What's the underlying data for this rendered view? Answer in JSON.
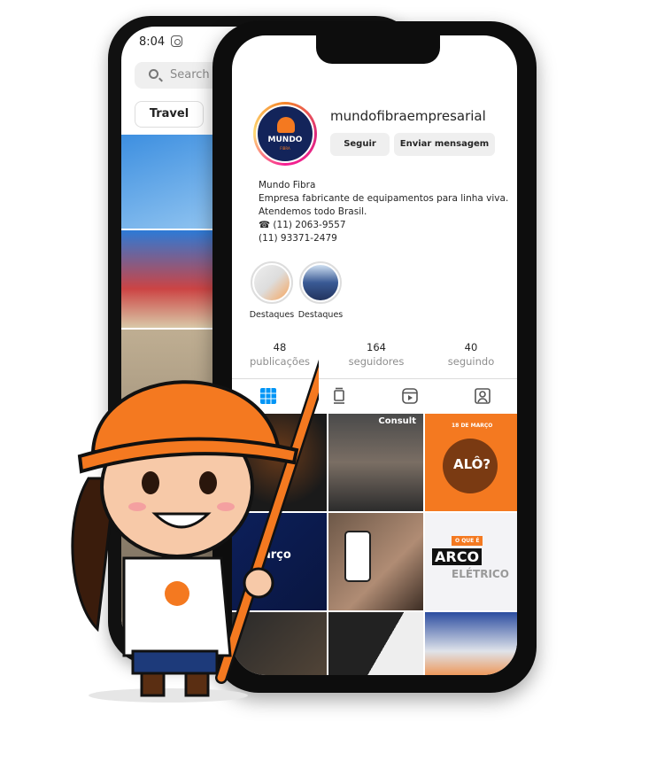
{
  "back_phone": {
    "status_time": "8:04",
    "search_placeholder": "Search",
    "chip": "Travel"
  },
  "profile": {
    "username": "mundofibraempresarial",
    "avatar_brand": "MUNDO",
    "avatar_sub": "FIBRA",
    "follow_button": "Seguir",
    "message_button": "Enviar mensagem",
    "name": "Mundo Fibra",
    "bio_line1": "Empresa fabricante de equipamentos para linha viva.",
    "bio_line2": "Atendemos todo Brasil.",
    "phone1": "☎ (11) 2063-9557",
    "phone2": "(11) 93371-2479",
    "highlights": [
      {
        "label": "Destaques"
      },
      {
        "label": "Destaques"
      }
    ],
    "stats": [
      {
        "value": "48",
        "label": "publicações"
      },
      {
        "value": "164",
        "label": "seguidores"
      },
      {
        "value": "40",
        "label": "seguindo"
      }
    ],
    "tabs": [
      "grid-icon",
      "igtv-icon",
      "reels-icon",
      "tagged-icon"
    ],
    "active_tab_color": "#0095f6"
  },
  "posts": {
    "p2_tag": "Consult",
    "p3_top": "18 DE MARÇO",
    "p3_title": "ALÔ?",
    "p5_blue": "arço",
    "p6_tag": "O QUE É",
    "p6_title": "ARCO",
    "p6_sub": "ELÉTRICO"
  },
  "colors": {
    "brand_orange": "#f47920",
    "brand_navy": "#13245a"
  }
}
